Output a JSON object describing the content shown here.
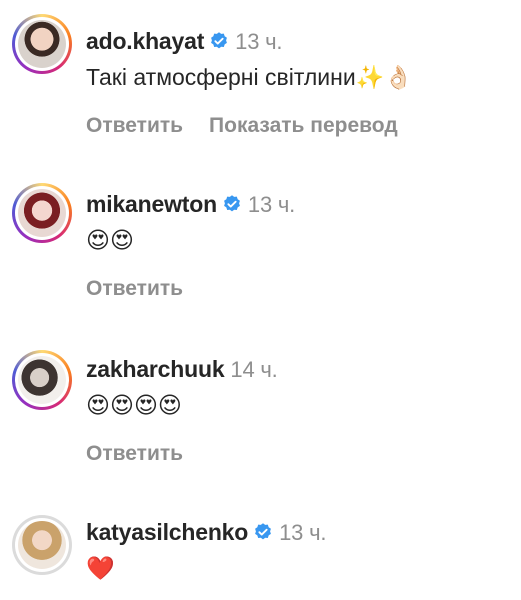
{
  "comments": [
    {
      "username": "ado.khayat",
      "verified": true,
      "time": "13 ч.",
      "text": "Такі атмосферні світлини✨👌🏻",
      "reply": "Ответить",
      "translate": "Показать перевод",
      "story_ring": true
    },
    {
      "username": "mikanewton",
      "verified": true,
      "time": "13 ч.",
      "text": "😍😍",
      "reply": "Ответить",
      "story_ring": true
    },
    {
      "username": "zakharchuuk",
      "verified": false,
      "time": "14 ч.",
      "text": "😍😍😍😍",
      "reply": "Ответить",
      "story_ring": true
    },
    {
      "username": "katyasilchenko",
      "verified": true,
      "time": "13 ч.",
      "text": "❤️",
      "story_ring": false
    }
  ],
  "colors": {
    "text": "#262626",
    "muted": "#8e8e8e",
    "verified": "#3897f0"
  },
  "icons": {
    "verified": "verified-badge-icon"
  }
}
